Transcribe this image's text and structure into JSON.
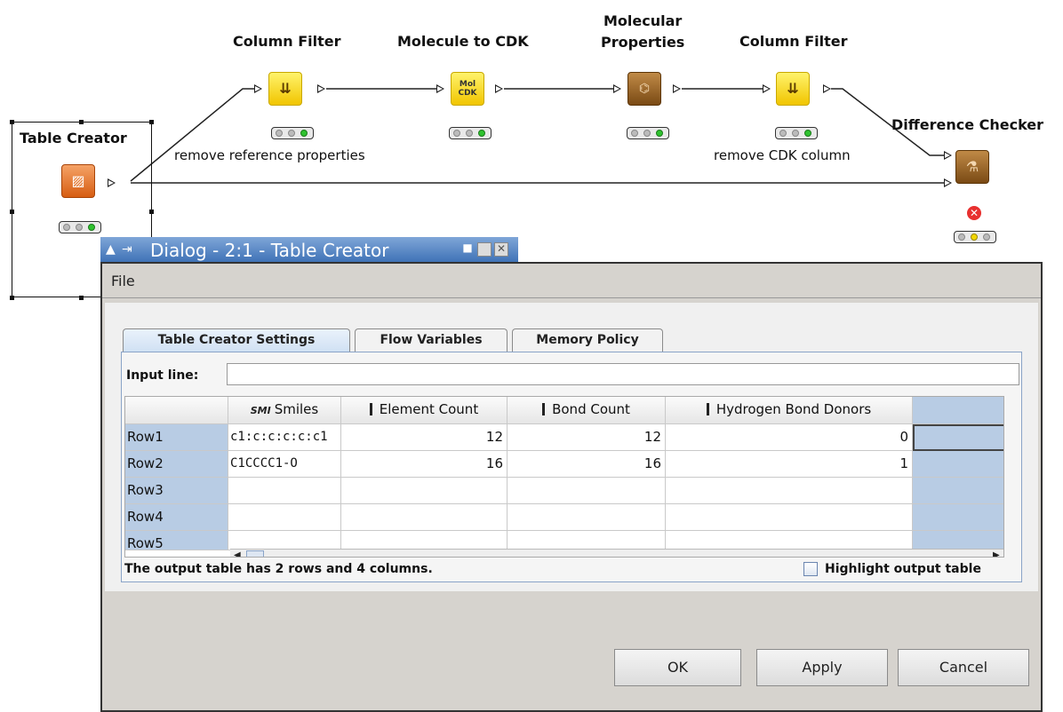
{
  "workflow": {
    "nodes": {
      "table_creator": {
        "title": "Table Creator"
      },
      "column_filter_1": {
        "title": "Column Filter",
        "label": "remove reference properties"
      },
      "molecule_to_cdk": {
        "title": "Molecule to CDK",
        "glyph": "Mol\nCDK"
      },
      "molecular_properties": {
        "title_line1": "Molecular",
        "title_line2": "Properties"
      },
      "column_filter_2": {
        "title": "Column Filter",
        "label": "remove CDK column"
      },
      "difference_checker": {
        "title": "Difference Checker",
        "status": "error"
      }
    },
    "colors": {
      "learner": "#f1c500",
      "manipulator": "#7a4a14",
      "source": "#d65d12",
      "ok": "#2fc22f",
      "warn": "#f2d600",
      "error": "#e8302f"
    }
  },
  "dialog": {
    "title": "Dialog - 2:1 - Table Creator",
    "menu": {
      "file": "File"
    },
    "tabs": [
      "Table Creator Settings",
      "Flow Variables",
      "Memory Policy"
    ],
    "input_label": "Input line:",
    "input_value": "",
    "table": {
      "columns": [
        {
          "label": "Smiles",
          "type_icon": "SMI"
        },
        {
          "label": "Element Count",
          "type_icon": "I"
        },
        {
          "label": "Bond Count",
          "type_icon": "I"
        },
        {
          "label": "Hydrogen Bond Donors",
          "type_icon": "I"
        }
      ],
      "rows": [
        {
          "id": "Row1",
          "cells": [
            "c1:c:c:c:c:c1",
            "12",
            "12",
            "0"
          ]
        },
        {
          "id": "Row2",
          "cells": [
            "C1CCCC1-O",
            "16",
            "16",
            "1"
          ]
        },
        {
          "id": "Row3",
          "cells": [
            "",
            "",
            "",
            ""
          ]
        },
        {
          "id": "Row4",
          "cells": [
            "",
            "",
            "",
            ""
          ]
        },
        {
          "id": "Row5",
          "cells": [
            "",
            "",
            "",
            ""
          ]
        }
      ]
    },
    "status_text": "The output table has 2 rows and 4 columns.",
    "highlight_label": "Highlight output table",
    "highlight_checked": false,
    "buttons": {
      "ok": "OK",
      "apply": "Apply",
      "cancel": "Cancel"
    }
  }
}
